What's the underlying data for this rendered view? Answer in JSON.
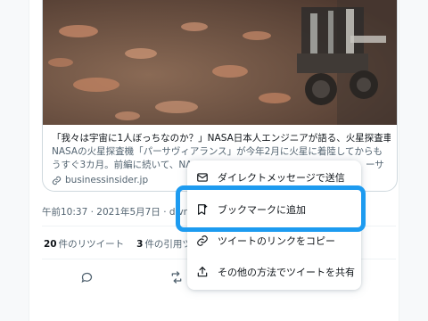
{
  "link_card": {
    "title": "「我々は宇宙に1人ぼっちなのか？」NASA日本人エンジニアが語る、火星探査車…",
    "description": "NASAの火星探査機「パーサヴィアランス」が今年2月に火星に着陸してからもうすぐ3カ月。前編に続いて、NASA",
    "description_tail": "ーサ",
    "domain": "businessinsider.jp"
  },
  "meta": {
    "timestamp": "午前10:37 · 2021年5月7日 · dlvr.it"
  },
  "stats": {
    "retweets_count": "20",
    "retweets_label": "件のリツイート",
    "quotes_count": "3",
    "quotes_label": "件の引用ツ"
  },
  "share_menu": {
    "items": [
      {
        "label": "ダイレクトメッセージで送信",
        "icon": "envelope-icon"
      },
      {
        "label": "ブックマークに追加",
        "icon": "bookmark-add-icon"
      },
      {
        "label": "ツイートのリンクをコピー",
        "icon": "link-icon"
      },
      {
        "label": "その他の方法でツイートを共有",
        "icon": "share-icon"
      }
    ]
  },
  "colors": {
    "accent": "#1d9bf0",
    "text": "#0f1419",
    "secondary": "#536471",
    "border": "#cfd9de"
  }
}
